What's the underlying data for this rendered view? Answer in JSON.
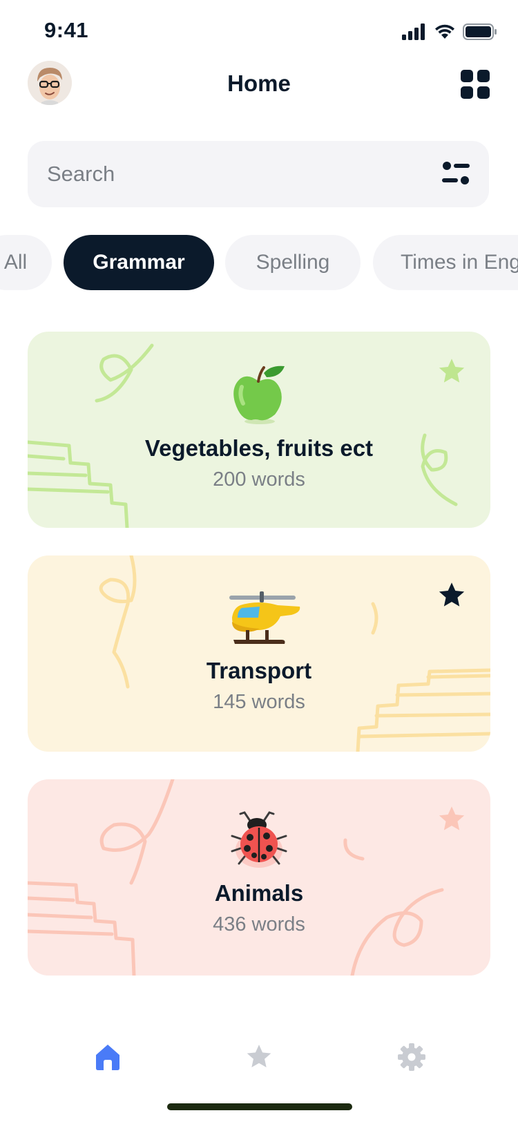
{
  "status_bar": {
    "time": "9:41"
  },
  "header": {
    "title": "Home"
  },
  "search": {
    "placeholder": "Search"
  },
  "tabs": [
    {
      "label": "All",
      "active": false
    },
    {
      "label": "Grammar",
      "active": true
    },
    {
      "label": "Spelling",
      "active": false
    },
    {
      "label": "Times in English",
      "active": false
    }
  ],
  "cards": [
    {
      "emoji": "🍏",
      "title": "Vegetables, fruits ect",
      "count": "200 words",
      "favorite": false,
      "bg": "#ecf5df",
      "accent": "#bfe68f"
    },
    {
      "emoji": "🚁",
      "title": "Transport",
      "count": "145 words",
      "favorite": true,
      "bg": "#fdf4de",
      "accent": "#fbe0a1"
    },
    {
      "emoji": "🐞",
      "title": "Animals",
      "count": "436 words",
      "favorite": false,
      "bg": "#fde8e4",
      "accent": "#fbc6b8"
    }
  ],
  "bottom_nav": [
    {
      "icon": "home-icon",
      "active": true
    },
    {
      "icon": "star-icon",
      "active": false
    },
    {
      "icon": "gear-icon",
      "active": false
    }
  ],
  "colors": {
    "primary_dark": "#0b1a2b",
    "nav_active": "#4a7bf7",
    "nav_inactive": "#c9ccd2",
    "muted_text": "#7a7f86"
  }
}
